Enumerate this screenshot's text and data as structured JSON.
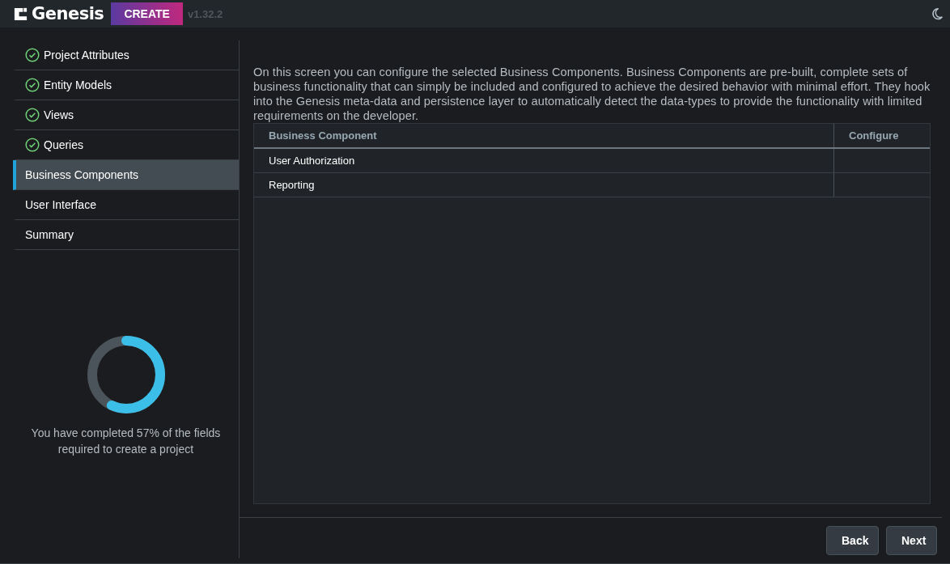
{
  "header": {
    "logo": "Genesis",
    "badge": "CREATE",
    "version": "v1.32.2"
  },
  "steps": [
    {
      "label": "Project Attributes",
      "completed": true,
      "selected": false
    },
    {
      "label": "Entity Models",
      "completed": true,
      "selected": false
    },
    {
      "label": "Views",
      "completed": true,
      "selected": false
    },
    {
      "label": "Queries",
      "completed": true,
      "selected": false
    },
    {
      "label": "Business Components",
      "completed": false,
      "selected": true
    },
    {
      "label": "User Interface",
      "completed": false,
      "selected": false
    },
    {
      "label": "Summary",
      "completed": false,
      "selected": false
    }
  ],
  "progress": {
    "level": 0.57,
    "text": "You have completed 57% of the fields required to create a project"
  },
  "description": "On this screen you can configure the selected Business Components. Business Components are pre-built, complete sets of business functionality that can simply be included and configured to achieve the desired behavior with minimal effort. They hook into the Genesis meta-data and persistence layer to automatically detect the data-types to provide the functionality with limited requirements on the developer.",
  "table": {
    "columns": [
      "Business Component",
      "Configure"
    ],
    "rows": [
      [
        "User Authorization"
      ],
      [
        "Reporting"
      ]
    ]
  },
  "buttons": [
    "Back",
    "Next"
  ]
}
